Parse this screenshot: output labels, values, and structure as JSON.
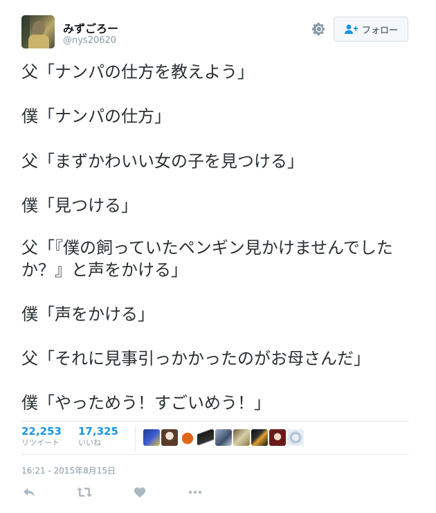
{
  "user": {
    "display_name": "みずごろー",
    "screen_name": "@nys20620"
  },
  "follow_button": {
    "label": "フォロー",
    "icon": "add-user-icon"
  },
  "settings_icon": "gear-icon",
  "tweet": {
    "lines": [
      "父「ナンパの仕方を教えよう」",
      "僕「ナンパの仕方」",
      "父「まずかわいい女の子を見つける」",
      "僕「見つける」",
      "父「『僕の飼っていたペンギン見かけませんでしたか？』と声をかける」",
      "僕「声をかける」",
      "父「それに見事引っかかったのがお母さんだ」",
      "僕「やっためう！すごいめう！」"
    ]
  },
  "stats": {
    "retweets": {
      "count": "22,253",
      "label": "リツイート"
    },
    "likes": {
      "count": "17,325",
      "label": "いいね"
    }
  },
  "likers_count_shown": 10,
  "timestamp": "16:21 - 2015年8月15日",
  "actions": [
    "reply-icon",
    "retweet-icon",
    "heart-icon",
    "more-icon"
  ],
  "colors": {
    "accent": "#1b95e0",
    "text": "#292f33",
    "muted": "#8899a6"
  }
}
